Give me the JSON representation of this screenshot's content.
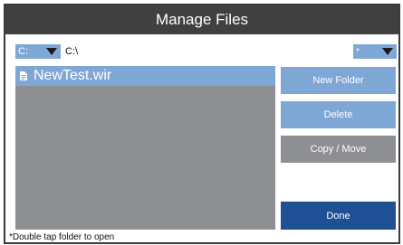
{
  "window": {
    "title": "Manage Files"
  },
  "toolbar": {
    "drive": "C:",
    "path": "C:\\",
    "filter": "*"
  },
  "file_list": {
    "items": [
      {
        "name": "NewTest.wir",
        "icon": "file-icon",
        "selected": true
      }
    ]
  },
  "buttons": {
    "new_folder": "New Folder",
    "delete": "Delete",
    "copy_move": "Copy / Move",
    "done": "Done"
  },
  "footer": {
    "note": "*Double tap folder to open"
  },
  "colors": {
    "titlebar": "#404040",
    "accent": "#7ea7d6",
    "disabled": "#8e8f93",
    "primary": "#1f4f94"
  }
}
